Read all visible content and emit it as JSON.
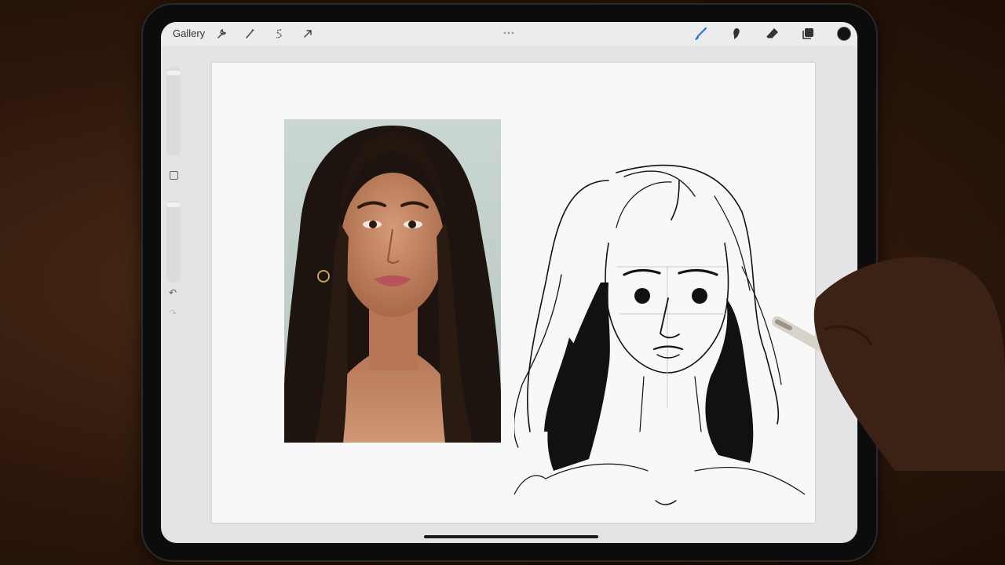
{
  "toolbar": {
    "gallery_label": "Gallery",
    "left_tools": [
      "wrench-icon",
      "magic-wand-icon",
      "selection-icon",
      "transform-arrow-icon"
    ],
    "right_tools": [
      "brush-icon",
      "smudge-icon",
      "eraser-icon",
      "layers-icon"
    ],
    "active_tool": "brush-icon",
    "accent_color": "#2f6fe0",
    "current_color": "#111111"
  },
  "sidebar": {
    "undo_icon": "↶",
    "redo_icon": "↷"
  },
  "canvas": {
    "reference_photo": "portrait-photo",
    "drawing": "ink-sketch-portrait"
  }
}
